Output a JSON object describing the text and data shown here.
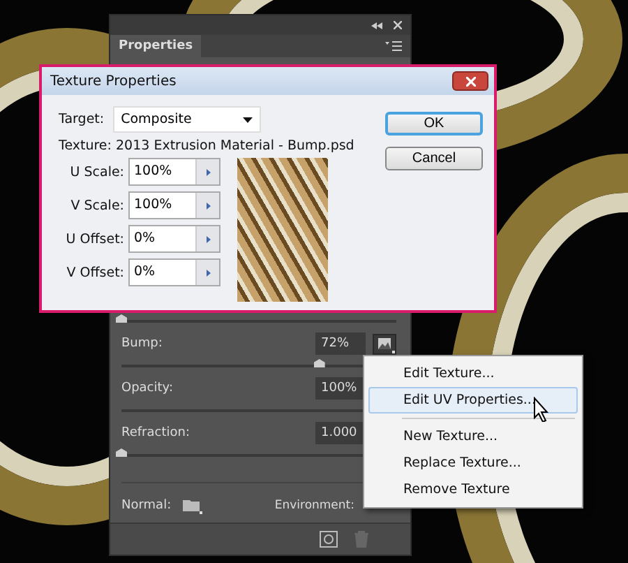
{
  "panel": {
    "tab": "Properties",
    "hidden_slider": {
      "level": 0
    },
    "sliders": [
      {
        "label": "Bump:",
        "value": "72%",
        "level": 0.72
      },
      {
        "label": "Opacity:",
        "value": "100%",
        "level": 1
      },
      {
        "label": "Refraction:",
        "value": "1.000",
        "level": 0
      }
    ],
    "normal_label": "Normal:",
    "environment_label": "Environment:"
  },
  "dialog": {
    "title": "Texture Properties",
    "target_label": "Target:",
    "target_value": "Composite",
    "texture_line": "Texture: 2013 Extrusion Material - Bump.psd",
    "fields": [
      {
        "label": "U Scale:",
        "value": "100%"
      },
      {
        "label": "V Scale:",
        "value": "100%"
      },
      {
        "label": "U Offset:",
        "value": "0%"
      },
      {
        "label": "V Offset:",
        "value": "0%"
      }
    ],
    "buttons": [
      {
        "label": "OK",
        "selected": true
      },
      {
        "label": "Cancel",
        "selected": false
      }
    ]
  },
  "menu": {
    "items": [
      {
        "label": "Edit Texture...",
        "selected": false,
        "separator_after": false
      },
      {
        "label": "Edit UV Properties...",
        "selected": true,
        "separator_after": true
      },
      {
        "label": "New Texture...",
        "selected": false,
        "separator_after": false
      },
      {
        "label": "Replace Texture...",
        "selected": false,
        "separator_after": false
      },
      {
        "label": "Remove Texture",
        "selected": false,
        "separator_after": false
      }
    ]
  }
}
